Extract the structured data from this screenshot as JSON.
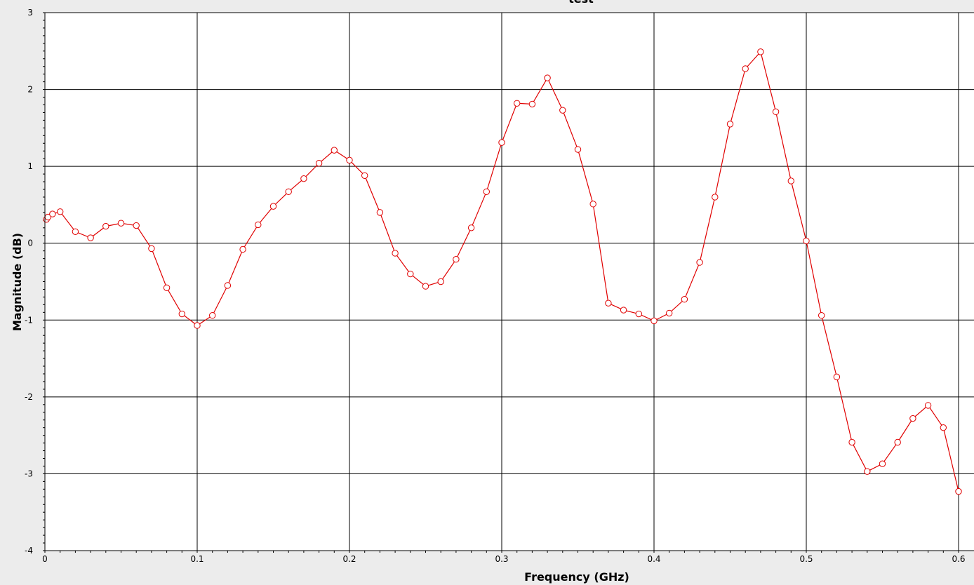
{
  "chart_data": {
    "type": "line",
    "title": "test",
    "xlabel": "Frequency (GHz)",
    "ylabel": "Magnitude (dB)",
    "xlim": [
      0,
      0.6
    ],
    "ylim": [
      -4,
      3
    ],
    "grid": true,
    "x_ticks": [
      {
        "value": 0,
        "label": "0"
      },
      {
        "value": 0.1,
        "label": "0.1"
      },
      {
        "value": 0.2,
        "label": "0.2"
      },
      {
        "value": 0.3,
        "label": "0.3"
      },
      {
        "value": 0.4,
        "label": "0.4"
      },
      {
        "value": 0.5,
        "label": "0.5"
      },
      {
        "value": 0.6,
        "label": "0.6"
      }
    ],
    "y_ticks": [
      {
        "value": -4,
        "label": "-4"
      },
      {
        "value": -3,
        "label": "-3"
      },
      {
        "value": -2,
        "label": "-2"
      },
      {
        "value": -1,
        "label": "-1"
      },
      {
        "value": 0,
        "label": "0"
      },
      {
        "value": 1,
        "label": "1"
      },
      {
        "value": 2,
        "label": "2"
      },
      {
        "value": 3,
        "label": "3"
      }
    ],
    "series": [
      {
        "color": "#e00000",
        "marker": "open-circle",
        "x": [
          0.001,
          0.002,
          0.005,
          0.01,
          0.02,
          0.03,
          0.04,
          0.05,
          0.06,
          0.07,
          0.08,
          0.09,
          0.1,
          0.11,
          0.12,
          0.13,
          0.14,
          0.15,
          0.16,
          0.17,
          0.18,
          0.19,
          0.2,
          0.21,
          0.22,
          0.23,
          0.24,
          0.25,
          0.26,
          0.27,
          0.28,
          0.29,
          0.3,
          0.31,
          0.32,
          0.33,
          0.34,
          0.35,
          0.36,
          0.37,
          0.38,
          0.39,
          0.4,
          0.41,
          0.42,
          0.43,
          0.44,
          0.45,
          0.46,
          0.47,
          0.48,
          0.49,
          0.5,
          0.51,
          0.52,
          0.53,
          0.54,
          0.55,
          0.56,
          0.57,
          0.58,
          0.59,
          0.6
        ],
        "y": [
          0.31,
          0.34,
          0.38,
          0.41,
          0.15,
          0.07,
          0.22,
          0.26,
          0.23,
          -0.07,
          -0.58,
          -0.92,
          -1.07,
          -0.94,
          -0.55,
          -0.08,
          0.24,
          0.48,
          0.67,
          0.84,
          1.04,
          1.21,
          1.08,
          0.88,
          0.4,
          -0.13,
          -0.4,
          -0.56,
          -0.5,
          -0.21,
          0.2,
          0.67,
          1.31,
          1.82,
          1.81,
          2.15,
          1.73,
          1.22,
          0.51,
          -0.78,
          -0.87,
          -0.92,
          -1.01,
          -0.91,
          -0.73,
          -0.25,
          0.6,
          1.55,
          2.27,
          2.49,
          1.71,
          0.81,
          0.03,
          -0.94,
          -1.74,
          -2.59,
          -2.97,
          -2.87,
          -2.59,
          -2.28,
          -2.11,
          -2.4,
          -3.23
        ]
      }
    ]
  }
}
